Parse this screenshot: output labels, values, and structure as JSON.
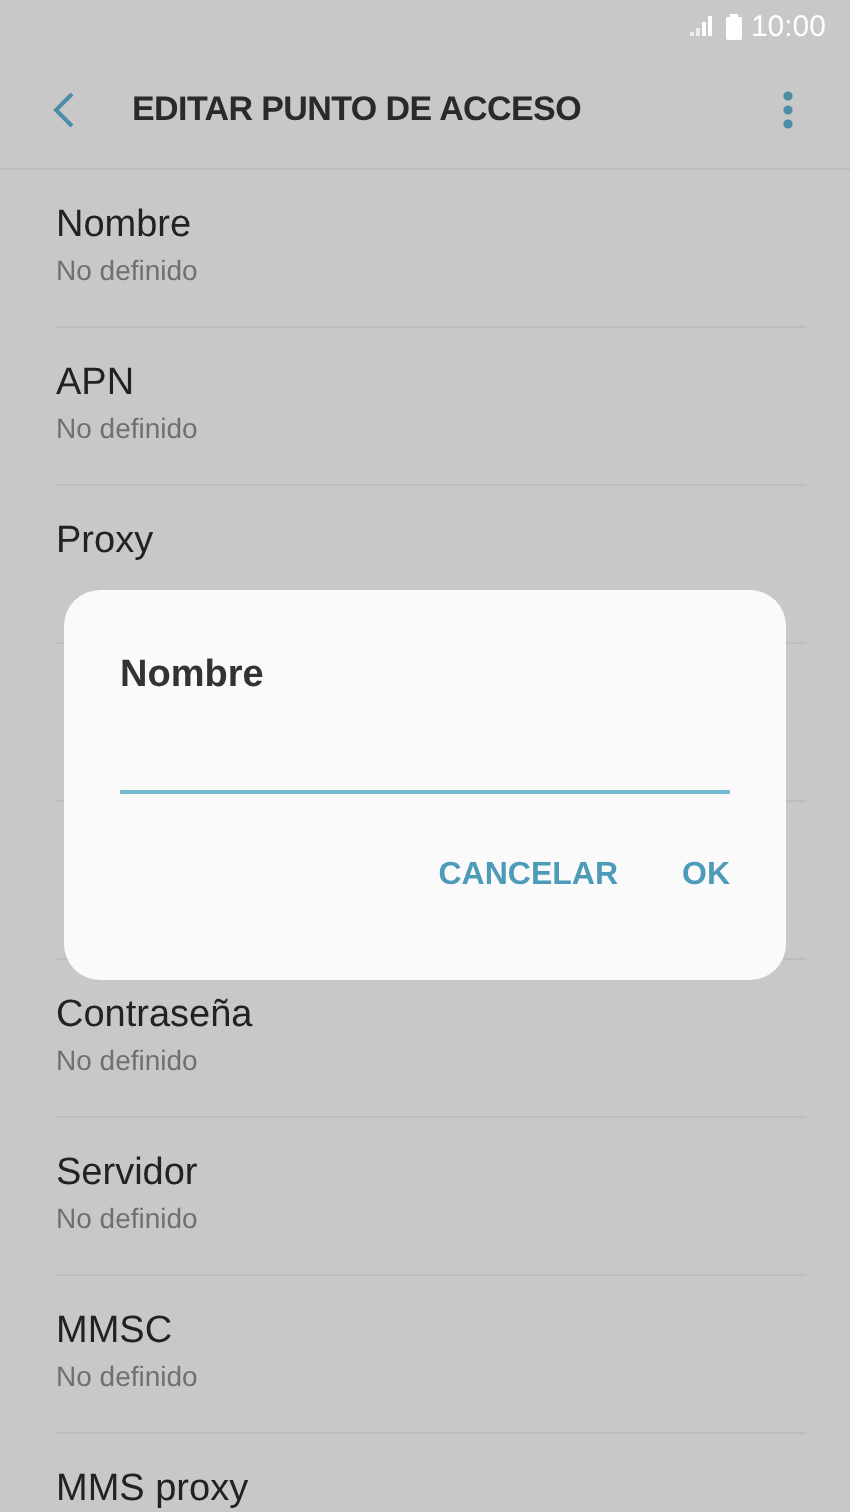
{
  "status_bar": {
    "time": "10:00"
  },
  "toolbar": {
    "title": "EDITAR PUNTO DE ACCESO"
  },
  "items_above": [
    {
      "title": "Nombre",
      "subtitle": "No definido"
    },
    {
      "title": "APN",
      "subtitle": "No definido"
    },
    {
      "title": "Proxy"
    }
  ],
  "items_below": [
    {
      "title": "Contraseña",
      "subtitle": "No definido"
    },
    {
      "title": "Servidor",
      "subtitle": "No definido"
    },
    {
      "title": "MMSC",
      "subtitle": "No definido"
    },
    {
      "title": "MMS proxy"
    }
  ],
  "dialog": {
    "title": "Nombre",
    "buttons": [
      "CANCELAR",
      "OK"
    ]
  }
}
